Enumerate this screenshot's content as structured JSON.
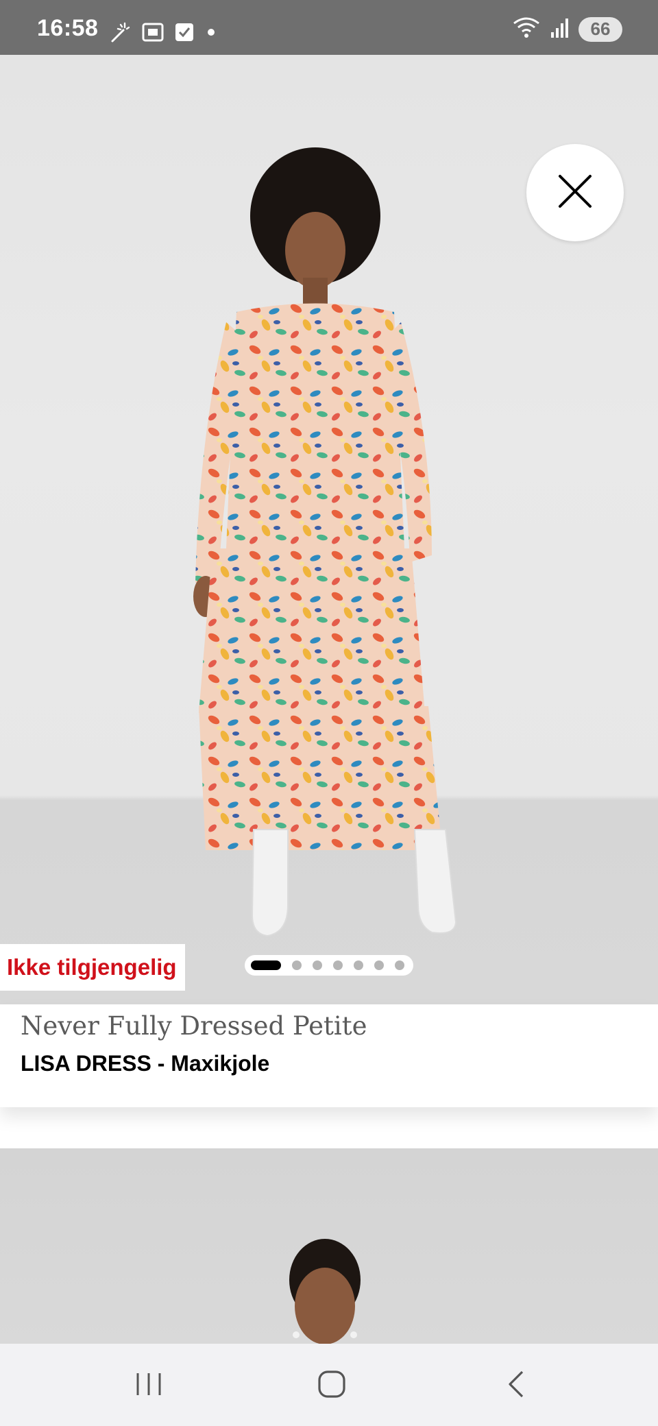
{
  "status_bar": {
    "time": "16:58",
    "battery_level": "66",
    "left_icons": [
      "magic-wand-icon",
      "screenshot-icon",
      "checkbox-icon",
      "dot-icon"
    ],
    "right_icons": [
      "wifi-icon",
      "signal-icon",
      "battery-icon"
    ]
  },
  "product": {
    "availability_label": "Ikke tilgjengelig",
    "brand": "Never Fully Dressed Petite",
    "name": "LISA DRESS - Maxikjole",
    "image_count": 7,
    "active_image_index": 0,
    "close_icon": "close-icon"
  },
  "navigation": {
    "items": [
      "recent-apps-icon",
      "home-icon",
      "back-icon"
    ]
  },
  "colors": {
    "status_bar": "#6f6f6f",
    "availability_text": "#d0111b",
    "brand_text": "#5a5a5a",
    "product_name_text": "#000000",
    "nav_bar": "#f2f2f4"
  }
}
